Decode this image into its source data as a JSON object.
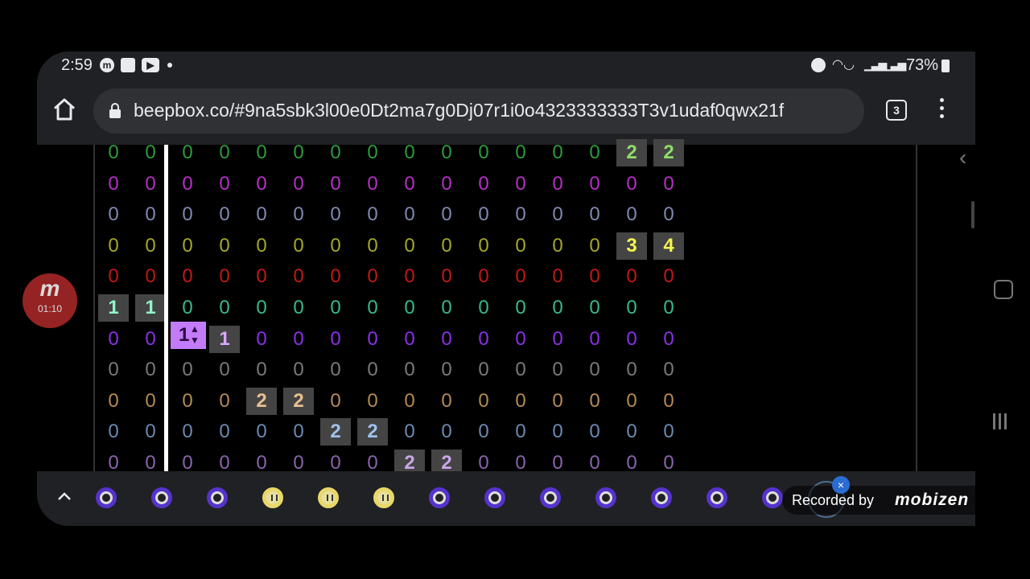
{
  "status_bar": {
    "time": "2:59",
    "battery": "73%",
    "icons": [
      "mobizen-icon",
      "message-icon",
      "youtube-icon",
      "alarm-icon",
      "wifi-call-icon",
      "signal-icon",
      "battery-icon"
    ]
  },
  "browser": {
    "url": "beepbox.co/#9na5sbk3l00e0Dt2ma7g0Dj07r1i0o4323333333T3v1udaf0qwx21f",
    "tab_count": "3"
  },
  "grid": {
    "colors": [
      "#2f9a3a",
      "#b52fc7",
      "#7f89b0",
      "#a4a828",
      "#c01818",
      "#37b98a",
      "#8a30e8",
      "#7a7a7a",
      "#b58a55",
      "#6a8ab2",
      "#8a63ac"
    ],
    "filled_text_colors": [
      "#8fdc6a",
      "#f067f0",
      "#a4b0d8",
      "#f5f54e",
      "#ff4040",
      "#90f5c8",
      "#d9a6ff",
      "#bbbbbb",
      "#e8c090",
      "#9ec2ea",
      "#c9a6e8"
    ],
    "rows": [
      [
        "0",
        "0",
        "0",
        "0",
        "0",
        "0",
        "0",
        "0",
        "0",
        "0",
        "0",
        "0",
        "0",
        "0",
        "2",
        "2"
      ],
      [
        "0",
        "0",
        "0",
        "0",
        "0",
        "0",
        "0",
        "0",
        "0",
        "0",
        "0",
        "0",
        "0",
        "0",
        "0",
        "0"
      ],
      [
        "0",
        "0",
        "0",
        "0",
        "0",
        "0",
        "0",
        "0",
        "0",
        "0",
        "0",
        "0",
        "0",
        "0",
        "0",
        "0"
      ],
      [
        "0",
        "0",
        "0",
        "0",
        "0",
        "0",
        "0",
        "0",
        "0",
        "0",
        "0",
        "0",
        "0",
        "0",
        "3",
        "4"
      ],
      [
        "0",
        "0",
        "0",
        "0",
        "0",
        "0",
        "0",
        "0",
        "0",
        "0",
        "0",
        "0",
        "0",
        "0",
        "0",
        "0"
      ],
      [
        "1",
        "1",
        "0",
        "0",
        "0",
        "0",
        "0",
        "0",
        "0",
        "0",
        "0",
        "0",
        "0",
        "0",
        "0",
        "0"
      ],
      [
        "0",
        "0",
        "1",
        "1",
        "0",
        "0",
        "0",
        "0",
        "0",
        "0",
        "0",
        "0",
        "0",
        "0",
        "0",
        "0"
      ],
      [
        "0",
        "0",
        "0",
        "0",
        "0",
        "0",
        "0",
        "0",
        "0",
        "0",
        "0",
        "0",
        "0",
        "0",
        "0",
        "0"
      ],
      [
        "0",
        "0",
        "0",
        "0",
        "2",
        "2",
        "0",
        "0",
        "0",
        "0",
        "0",
        "0",
        "0",
        "0",
        "0",
        "0"
      ],
      [
        "0",
        "0",
        "0",
        "0",
        "0",
        "0",
        "2",
        "2",
        "0",
        "0",
        "0",
        "0",
        "0",
        "0",
        "0",
        "0"
      ],
      [
        "0",
        "0",
        "0",
        "0",
        "0",
        "0",
        "0",
        "0",
        "2",
        "2",
        "0",
        "0",
        "0",
        "0",
        "0",
        "0"
      ]
    ],
    "selected_value": "1"
  },
  "bottom_tracks": [
    "pitch",
    "pitch",
    "pitch",
    "drum",
    "drum",
    "drum",
    "pitch",
    "pitch",
    "pitch",
    "pitch",
    "pitch",
    "pitch",
    "pitch"
  ],
  "mobizen": {
    "logo": "m",
    "timer": "01:10",
    "recorded_label": "Recorded by",
    "brand": "mobizen"
  }
}
